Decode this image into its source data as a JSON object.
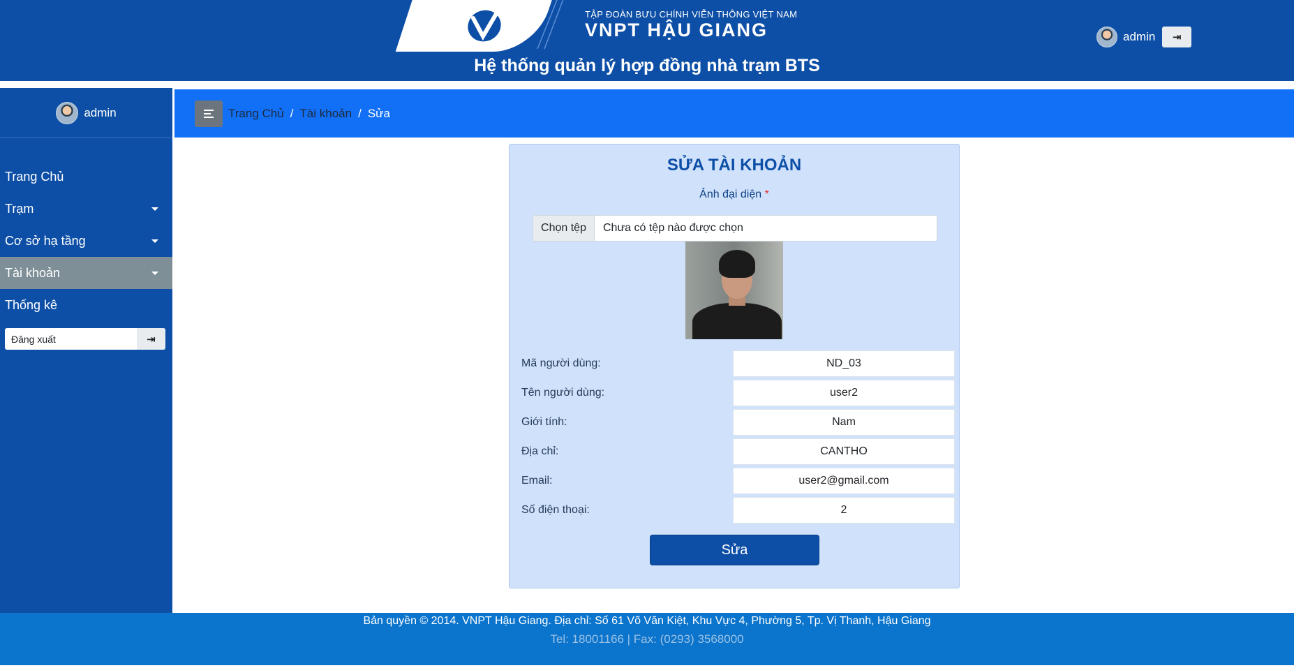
{
  "header": {
    "brand_sub": "TẬP ĐOÀN BƯU CHÍNH VIỄN THÔNG VIỆT NAM",
    "brand_main": "VNPT HẬU GIANG",
    "system_title": "Hệ thống quản lý hợp đồng nhà trạm BTS",
    "user_name": "admin"
  },
  "sidebar": {
    "user_name": "admin",
    "items": [
      {
        "label": "Trang Chủ"
      },
      {
        "label": "Trạm"
      },
      {
        "label": "Cơ sở hạ tầng"
      },
      {
        "label": "Tài khoản"
      },
      {
        "label": "Thống kê"
      }
    ],
    "logout_label": "Đăng xuất"
  },
  "breadcrumb": {
    "items": [
      "Trang Chủ",
      "Tài khoản",
      "Sửa"
    ],
    "separator": "/"
  },
  "form": {
    "title": "SỬA TÀI KHOẢN",
    "avatar_label": "Ảnh đại diện",
    "required_mark": "*",
    "file_button": "Chọn tệp",
    "file_status": "Chưa có tệp nào được chọn",
    "fields": [
      {
        "label": "Mã người dùng:",
        "value": "ND_03"
      },
      {
        "label": "Tên người dùng:",
        "value": "user2"
      },
      {
        "label": "Giới tính:",
        "value": "Nam"
      },
      {
        "label": "Địa chỉ:",
        "value": "CANTHO"
      },
      {
        "label": "Email:",
        "value": "user2@gmail.com"
      },
      {
        "label": "Số điện thoại:",
        "value": "2"
      }
    ],
    "submit_label": "Sửa"
  },
  "footer": {
    "line1": "Bản quyền © 2014. VNPT Hậu Giang. Địa chỉ: Số 61 Võ Văn Kiệt, Khu Vực 4, Phường 5, Tp. Vị Thanh, Hậu Giang",
    "line2": "Tel: 18001166 | Fax: (0293) 3568000"
  },
  "icons": {
    "logout": "logout-icon",
    "menu_toggle": "menu-toggle-icon",
    "caret": "caret-down-icon"
  },
  "colors": {
    "primary": "#0d4fa6",
    "breadcrumb_bar": "#1270f7",
    "card_bg": "#d0e2fb",
    "active_menu": "#7e8f98",
    "footer": "#0b74cc"
  }
}
